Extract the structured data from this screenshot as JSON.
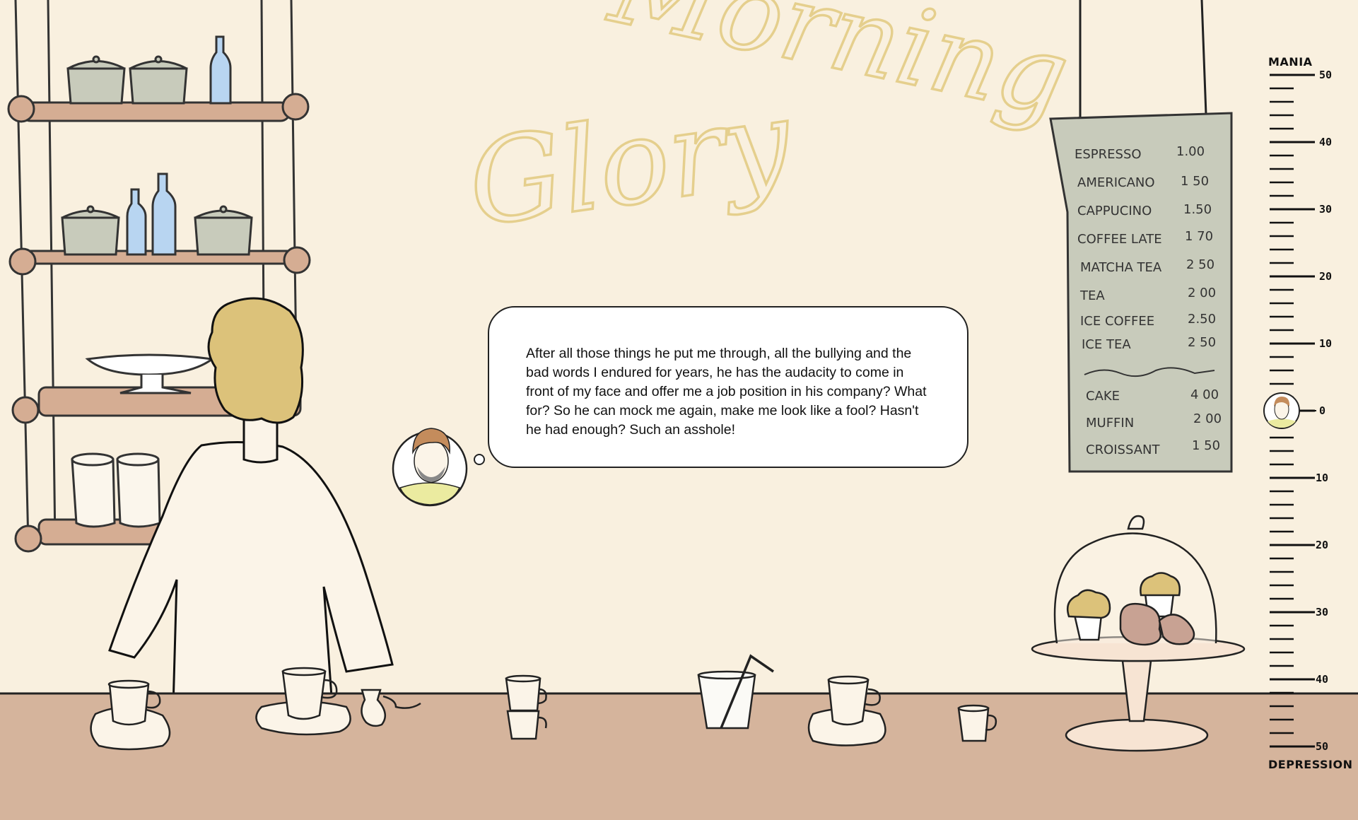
{
  "game": {
    "sign_words": [
      "Morning",
      "Glory"
    ],
    "thought": "After all those things he put me through, all the bullying and the bad words I endured for years, he has the audacity to come in front of my face and offer me a job position in his company? What for? So he can mock me again, make me look like a fool? Hasn't he had enough? Such an asshole!",
    "menu": {
      "drinks": [
        {
          "name": "ESPRESSO",
          "price": "1.00"
        },
        {
          "name": "AMERICANO",
          "price": "1 50"
        },
        {
          "name": "CAPPUCINO",
          "price": "1.50"
        },
        {
          "name": "COFFEE LATE",
          "price": "1 70"
        },
        {
          "name": "MATCHA TEA",
          "price": "2 50"
        },
        {
          "name": "TEA",
          "price": "2 00"
        },
        {
          "name": "ICE COFFEE",
          "price": "2.50"
        },
        {
          "name": "ICE TEA",
          "price": "2 50"
        }
      ],
      "food": [
        {
          "name": "CAKE",
          "price": "4 00"
        },
        {
          "name": "MUFFIN",
          "price": "2 00"
        },
        {
          "name": "CROISSANT",
          "price": "1 50"
        }
      ]
    },
    "mood_meter": {
      "top_label": "MANIA",
      "bottom_label": "DEPRESSION",
      "tick_labels": [
        "50",
        "40",
        "30",
        "20",
        "10",
        "0",
        "-10",
        "-20",
        "-30",
        "-40",
        "-50"
      ],
      "current_value": 0
    },
    "colors": {
      "background": "#f9f0df",
      "counter": "#d5b49c",
      "shelf": "#d5ad93",
      "hair": "#dcc27a",
      "neon": "#e5cf8d",
      "menu_board": "#c8cbbb",
      "bottle": "#b8d5f1"
    }
  }
}
